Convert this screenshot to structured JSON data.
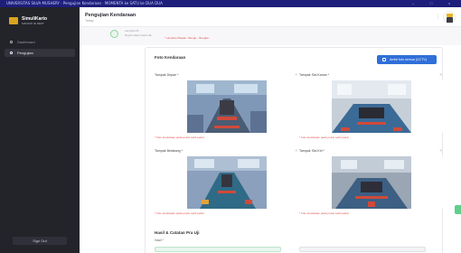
{
  "window": {
    "title": "UNIVERSITAS SILVA MUSHERY · Pengujian Kendaraan · MOMENTA ke SATU ke DUA DUA"
  },
  "brand": {
    "name": "SimuliKarto",
    "tagline": "MANTAP ID DEPT"
  },
  "sidebar": {
    "items": [
      {
        "label": "Dashboard",
        "active": false,
        "icon": "grid-icon"
      },
      {
        "label": "Pengujian",
        "active": true,
        "icon": "clipboard-icon"
      }
    ],
    "signout_label": "Sign Out"
  },
  "header": {
    "title": "Pengujian Kendaraan",
    "subtitle": "Tahap"
  },
  "step": {
    "line1": "Lampiran B",
    "line2": "Deputi Jalan Fasili UE",
    "note": "* Lampiran Bapak - Bengk... Bengka..."
  },
  "card": {
    "title": "Foto Kendaraan",
    "button_label": "Ambil foto semua (CCTV)",
    "photos": [
      {
        "label": "Tampak Depan *",
        "error": "* Foto kendaraan pada posisi Lakb pedal"
      },
      {
        "label": "Tampak Sisi Kanan *",
        "error": "* Foto kendaraan pada posisi Lakb pedal"
      },
      {
        "label": "Tampak Belakang *",
        "error": "* Foto kendaraan pada posisi Lakb pedal"
      },
      {
        "label": "Tampak Sisi Kiri *",
        "error": "* Foto kendaraan pada posisi Lakb pedal"
      }
    ],
    "notes_title": "Hasil & Catatan Pra Uji",
    "notes_label": "Hasil *"
  },
  "colors": {
    "sidebar_bg": "#23232a",
    "titlebar_bg": "#1d1f7a",
    "primary_button": "#2f6fd8",
    "error_text": "#e05050",
    "accent_green": "#5fcf8a"
  }
}
